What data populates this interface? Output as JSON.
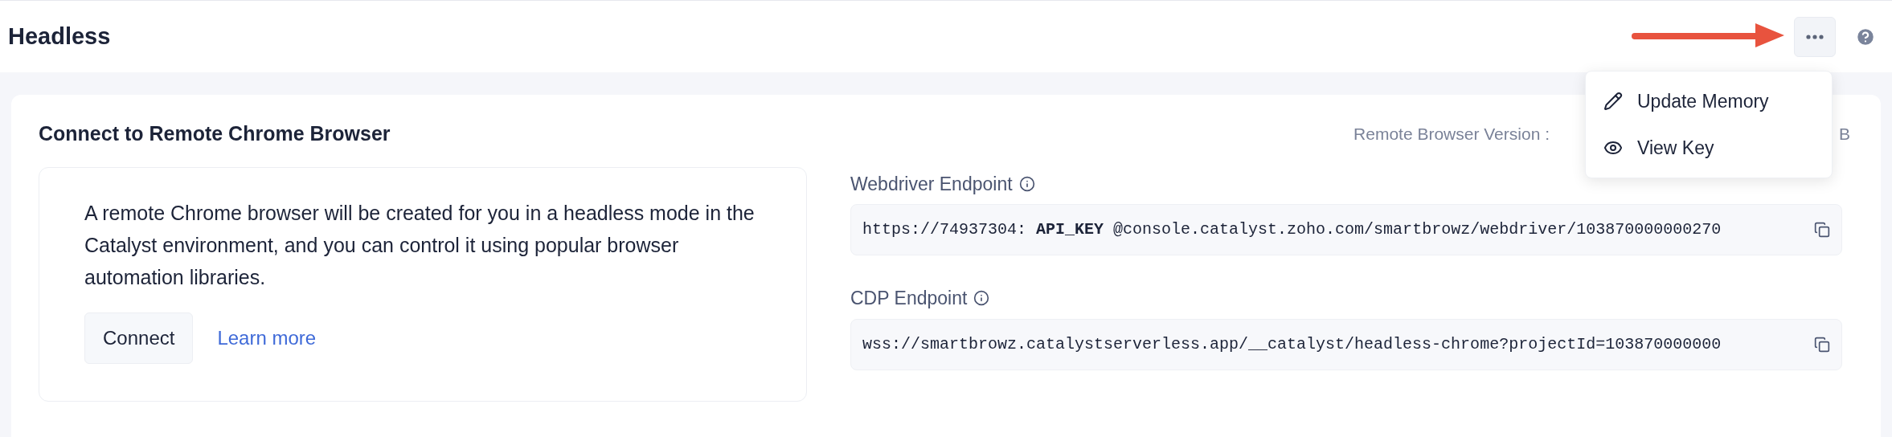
{
  "header": {
    "title": "Headless"
  },
  "menu": {
    "expanded": true,
    "items": [
      {
        "kind": "edit",
        "label": "Update Memory"
      },
      {
        "kind": "view",
        "label": "View Key"
      }
    ]
  },
  "card": {
    "title": "Connect to Remote Chrome Browser",
    "version_label": "Remote Browser Version :",
    "version_tail": "B",
    "intro": {
      "text": "A remote Chrome browser will be created for you in a headless mode in the Catalyst environment, and you can control it using popular browser automation libraries.",
      "button": "Connect",
      "link": "Learn more"
    },
    "endpoints": [
      {
        "label": "Webdriver Endpoint",
        "value": "https://74937304: **API_KEY** @console.catalyst.zoho.com/smartbrowz/webdriver/103870000000270"
      },
      {
        "label": "CDP Endpoint",
        "value": "wss://smartbrowz.catalystserverless.app/__catalyst/headless-chrome?projectId=103870000000"
      }
    ]
  }
}
